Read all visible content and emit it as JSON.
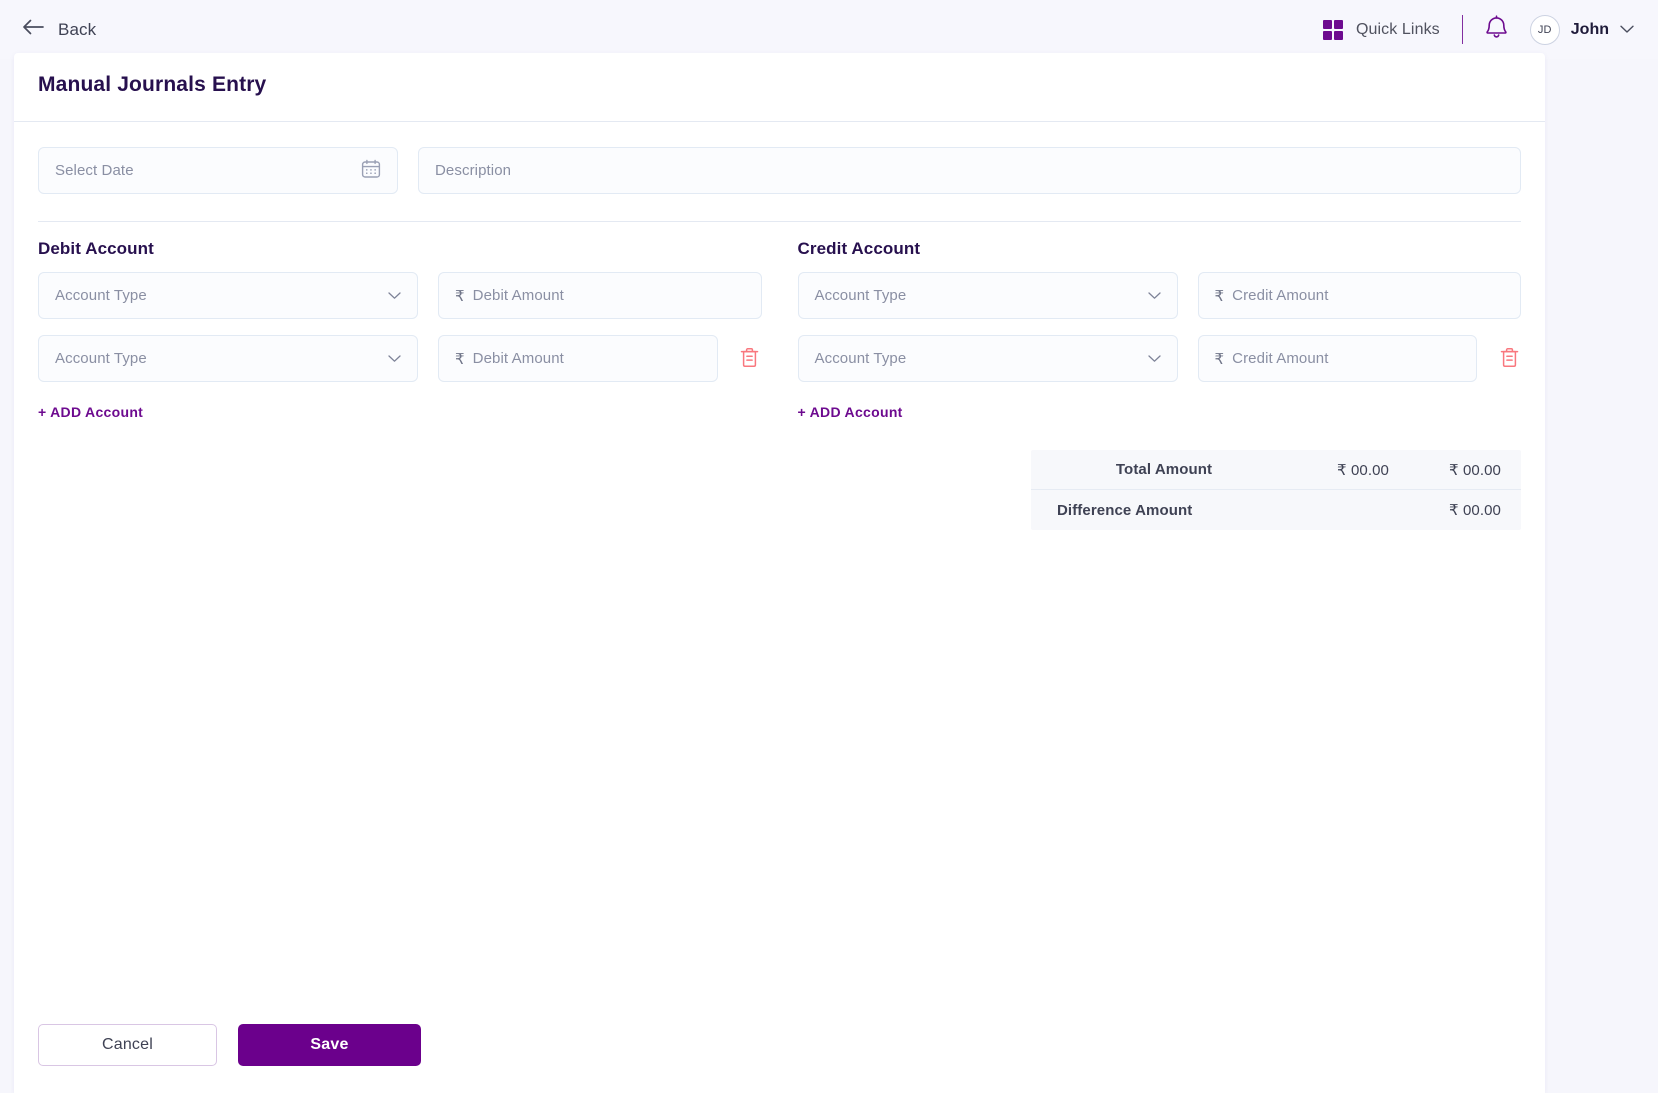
{
  "topbar": {
    "back_label": "Back",
    "quick_links_label": "Quick Links",
    "avatar_initials": "JD",
    "user_name": "John",
    "accent_color": "#6d0a8f"
  },
  "page": {
    "title": "Manual Journals Entry"
  },
  "form": {
    "date_placeholder": "Select Date",
    "date_value": "",
    "description_placeholder": "Description",
    "description_value": ""
  },
  "debit": {
    "section_title": "Debit Account",
    "add_link": "+ ADD Account",
    "rows": [
      {
        "account_type_placeholder": "Account Type",
        "account_type_value": "",
        "currency_symbol": "₹",
        "amount_placeholder": "Debit Amount",
        "amount_value": "",
        "has_delete": false
      },
      {
        "account_type_placeholder": "Account Type",
        "account_type_value": "",
        "currency_symbol": "₹",
        "amount_placeholder": "Debit Amount",
        "amount_value": "",
        "has_delete": true
      }
    ]
  },
  "credit": {
    "section_title": "Credit Account",
    "add_link": "+ ADD Account",
    "rows": [
      {
        "account_type_placeholder": "Account Type",
        "account_type_value": "",
        "currency_symbol": "₹",
        "amount_placeholder": "Credit Amount",
        "amount_value": "",
        "has_delete": false
      },
      {
        "account_type_placeholder": "Account Type",
        "account_type_value": "",
        "currency_symbol": "₹",
        "amount_placeholder": "Credit Amount",
        "amount_value": "",
        "has_delete": true
      }
    ]
  },
  "totals": {
    "total_label": "Total Amount",
    "total_debit": "₹ 00.00",
    "total_credit": "₹ 00.00",
    "difference_label": "Difference Amount",
    "difference_value": "₹ 00.00"
  },
  "footer": {
    "cancel_label": "Cancel",
    "save_label": "Save",
    "save_color": "#6b008c"
  }
}
